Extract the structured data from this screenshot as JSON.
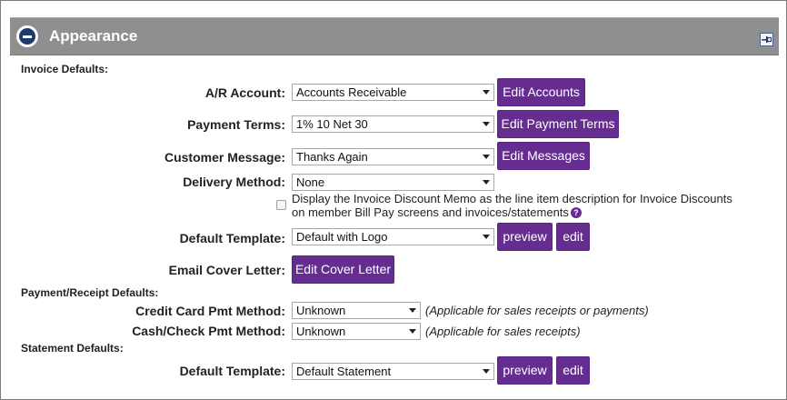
{
  "panel": {
    "title": "Appearance"
  },
  "invoice_defaults": {
    "heading": "Invoice Defaults:",
    "ar_account": {
      "label": "A/R Account:",
      "value": "Accounts Receivable",
      "button": "Edit Accounts"
    },
    "payment_terms": {
      "label": "Payment Terms:",
      "value": "1% 10 Net 30",
      "button": "Edit Payment Terms"
    },
    "customer_message": {
      "label": "Customer Message:",
      "value": "Thanks Again",
      "button": "Edit Messages"
    },
    "delivery_method": {
      "label": "Delivery Method:",
      "value": "None"
    },
    "discount_memo": {
      "checked": false,
      "text_line1": "Display the Invoice Discount Memo as the line item description for Invoice Discounts",
      "text_line2": "on member Bill Pay screens and invoices/statements",
      "help_glyph": "?"
    },
    "default_template": {
      "label": "Default Template:",
      "value": "Default with Logo",
      "preview_button": "preview",
      "edit_button": "edit"
    },
    "email_cover_letter": {
      "label": "Email Cover Letter:",
      "button": "Edit Cover Letter"
    }
  },
  "payment_receipt_defaults": {
    "heading": "Payment/Receipt Defaults:",
    "credit_card": {
      "label": "Credit Card Pmt Method:",
      "value": "Unknown",
      "note": "(Applicable for sales receipts or payments)"
    },
    "cash_check": {
      "label": "Cash/Check Pmt Method:",
      "value": "Unknown",
      "note": "(Applicable for sales receipts)"
    }
  },
  "statement_defaults": {
    "heading": "Statement Defaults:",
    "default_template": {
      "label": "Default Template:",
      "value": "Default Statement",
      "preview_button": "preview",
      "edit_button": "edit"
    }
  },
  "icons": {
    "collapse": "collapse-icon",
    "pin": "pin-icon",
    "dropdown": "chevron-down-icon",
    "help": "help-icon"
  },
  "colors": {
    "header_bg": "#8f8f8f",
    "button_bg": "#662d91",
    "collapse_icon": "#1f3b6b"
  }
}
